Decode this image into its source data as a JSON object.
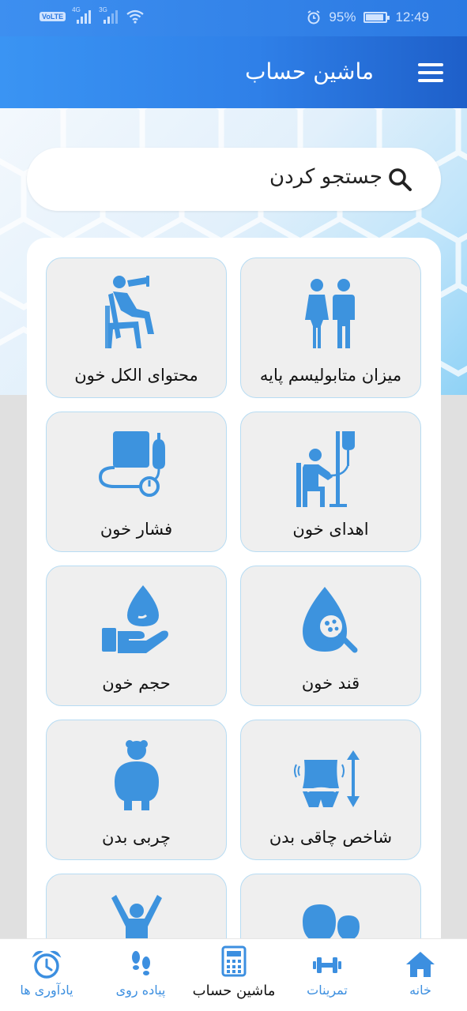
{
  "status_bar": {
    "network_badge": "VoLTE",
    "signal_1": "4G",
    "signal_2": "3G",
    "battery": "95%",
    "time": "12:49"
  },
  "app_bar": {
    "title": "ماشین حساب"
  },
  "search": {
    "label": "جستجو کردن"
  },
  "cards": [
    {
      "label": "میزان متابولیسم پایه",
      "icon": "people-icon"
    },
    {
      "label": "محتوای الکل خون",
      "icon": "drinking-person-icon"
    },
    {
      "label": "اهدای خون",
      "icon": "blood-donation-icon"
    },
    {
      "label": "فشار خون",
      "icon": "blood-pressure-monitor-icon"
    },
    {
      "label": "قند خون",
      "icon": "blood-sugar-drop-icon"
    },
    {
      "label": "حجم خون",
      "icon": "hand-drop-icon"
    },
    {
      "label": "شاخص چاقی بدن",
      "icon": "waist-measure-icon"
    },
    {
      "label": "چربی بدن",
      "icon": "body-fat-icon"
    },
    {
      "label": "",
      "icon": "heads-icon"
    },
    {
      "label": "",
      "icon": "person-arms-up-icon"
    }
  ],
  "nav": [
    {
      "label": "خانه",
      "icon": "home-icon",
      "active": false
    },
    {
      "label": "تمرینات",
      "icon": "dumbbell-icon",
      "active": false
    },
    {
      "label": "ماشین حساب",
      "icon": "calculator-icon",
      "active": true
    },
    {
      "label": "پیاده روی",
      "icon": "footsteps-icon",
      "active": false
    },
    {
      "label": "یادآوری ها",
      "icon": "alarm-clock-icon",
      "active": false
    }
  ],
  "colors": {
    "primary": "#2f80e8",
    "icon_blue": "#3d93de",
    "card_bg": "#efefef",
    "card_border": "#b7dcf3"
  }
}
